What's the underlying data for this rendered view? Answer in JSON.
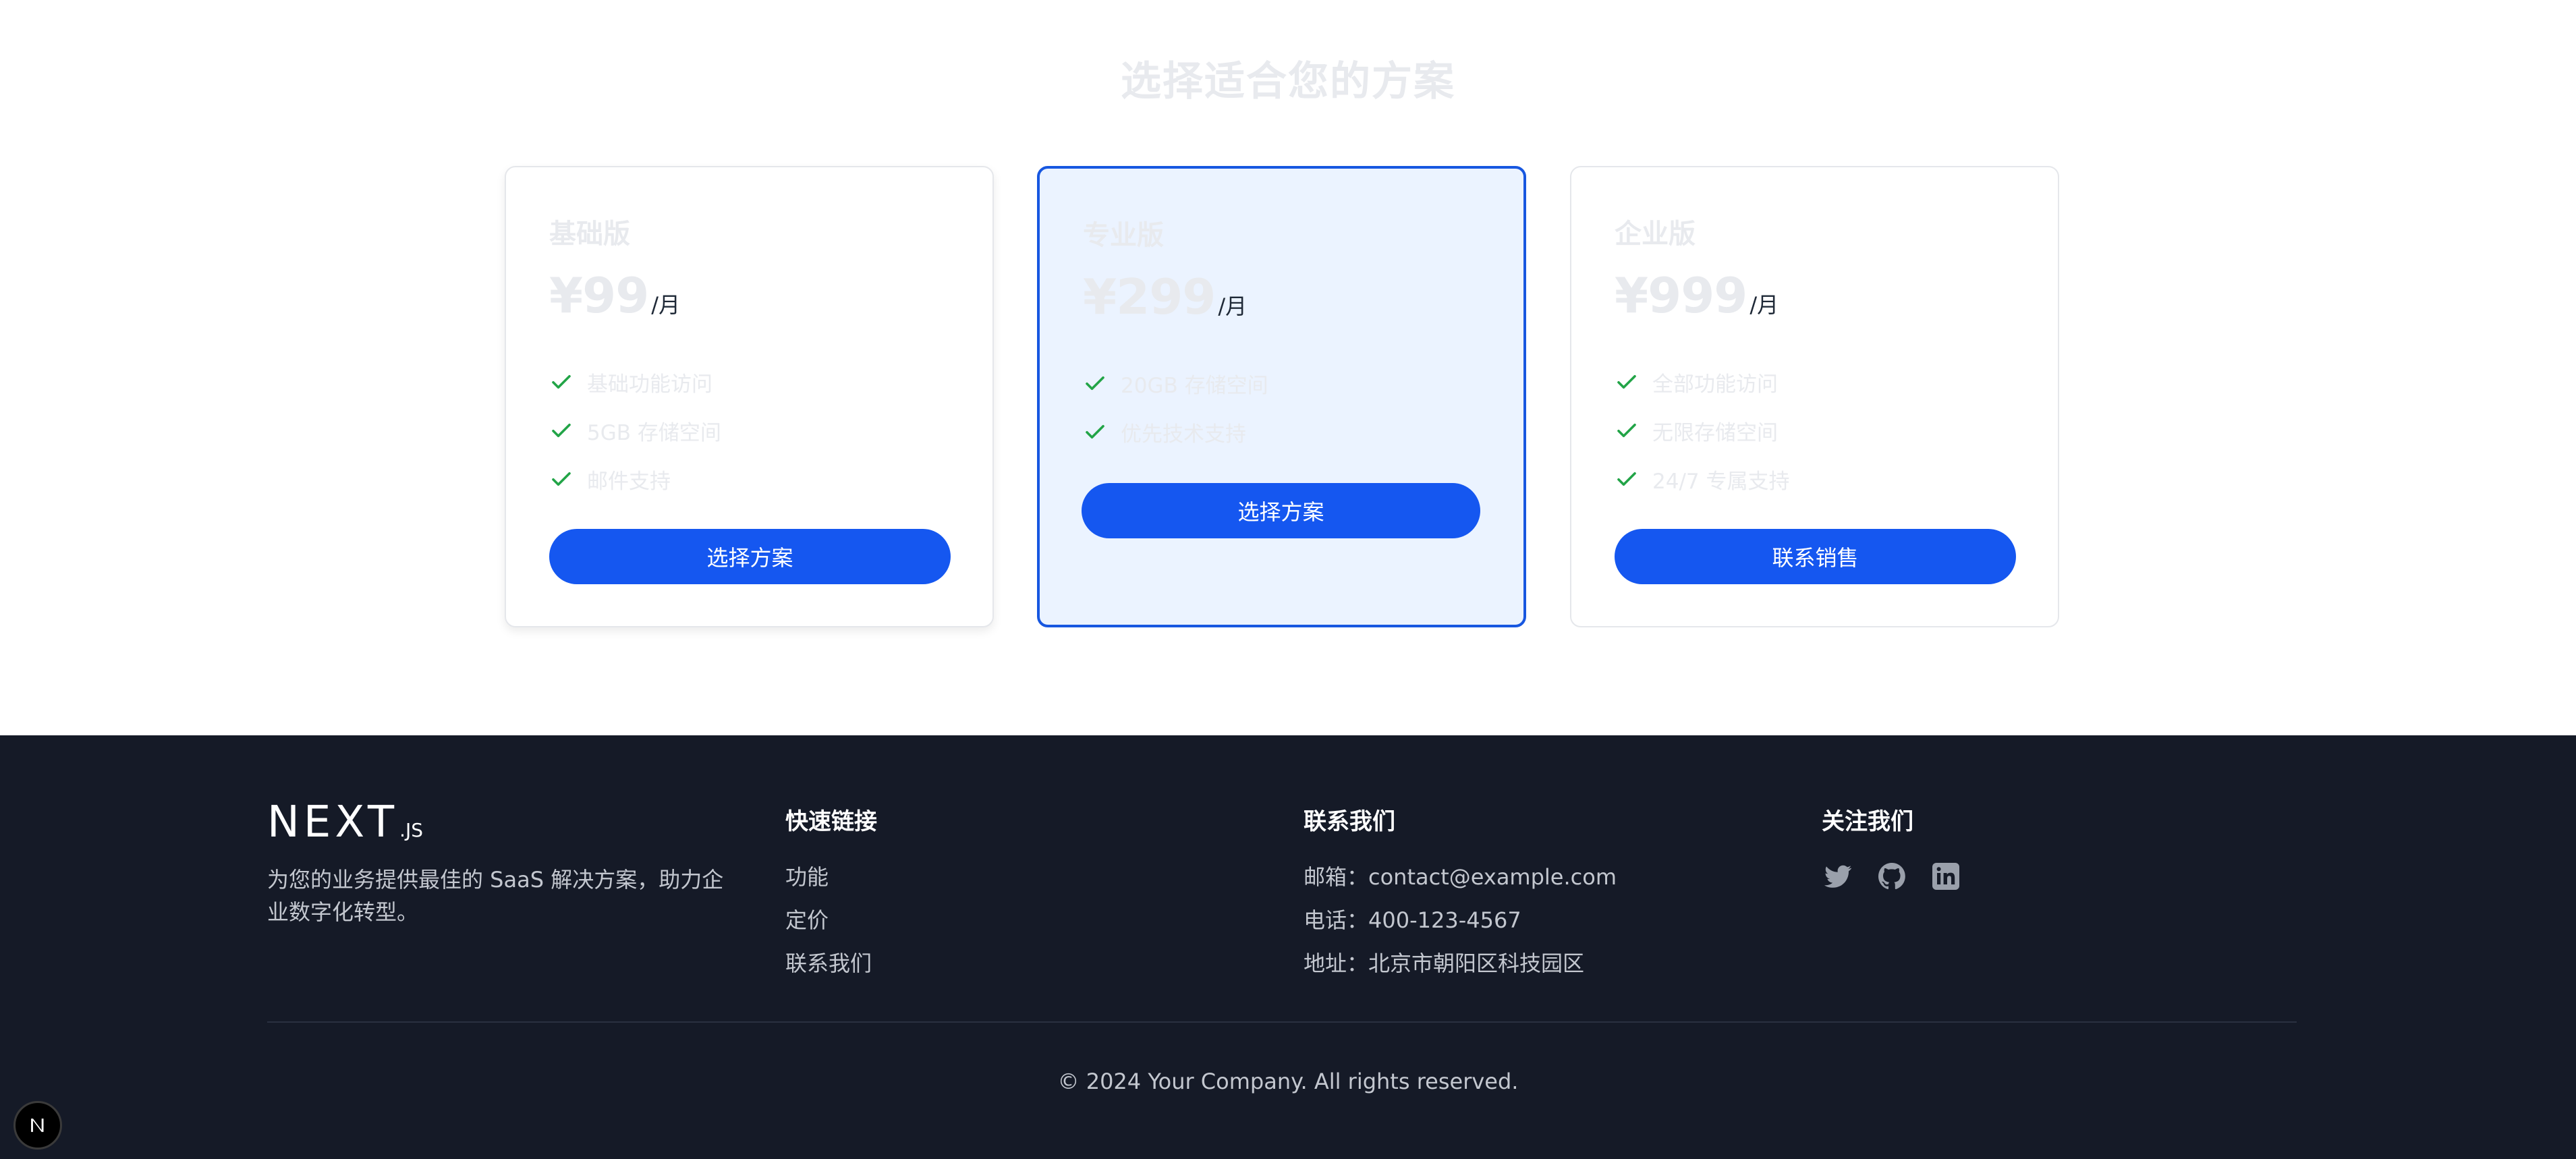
{
  "pricing": {
    "title": "选择适合您的方案",
    "plans": [
      {
        "name": "基础版",
        "price": "¥99",
        "period": "/月",
        "features": [
          "基础功能访问",
          "5GB 存储空间",
          "邮件支持"
        ],
        "cta": "选择方案"
      },
      {
        "name": "专业版",
        "price": "¥299",
        "period": "/月",
        "features": [
          "20GB 存储空间",
          "优先技术支持"
        ],
        "cta": "选择方案",
        "highlighted": true
      },
      {
        "name": "企业版",
        "price": "¥999",
        "period": "/月",
        "features": [
          "全部功能访问",
          "无限存储空间",
          "24/7 专属支持"
        ],
        "cta": "联系销售"
      }
    ]
  },
  "footer": {
    "logo_main": "NEXT",
    "logo_sub": ".JS",
    "description": "为您的业务提供最佳的 SaaS 解决方案，助力企业数字化转型。",
    "quick_links": {
      "title": "快速链接",
      "items": [
        "功能",
        "定价",
        "联系我们"
      ]
    },
    "contact": {
      "title": "联系我们",
      "email": "邮箱：contact@example.com",
      "phone": "电话：400-123-4567",
      "address": "地址：北京市朝阳区科技园区"
    },
    "follow": {
      "title": "关注我们",
      "icons": [
        "twitter-icon",
        "github-icon",
        "linkedin-icon"
      ]
    },
    "copyright": "© 2024 Your Company. All rights reserved."
  },
  "colors": {
    "primary": "#1557f0",
    "highlight_bg": "#ebf3ff",
    "check": "#22a447",
    "footer_bg": "#151a27"
  }
}
